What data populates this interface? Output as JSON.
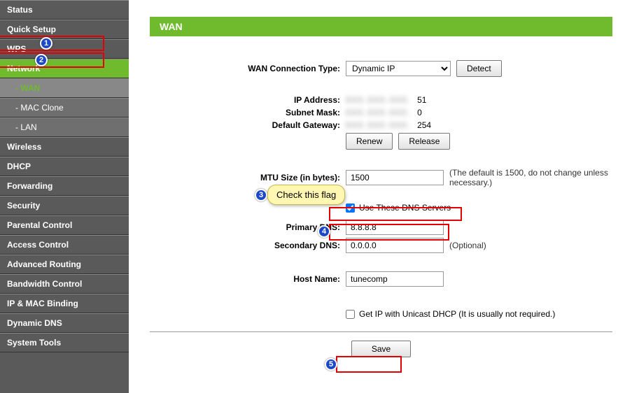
{
  "sidebar": {
    "items": [
      {
        "label": "Status"
      },
      {
        "label": "Quick Setup"
      },
      {
        "label": "WPS"
      },
      {
        "label": "Network"
      },
      {
        "label": "Wireless"
      },
      {
        "label": "DHCP"
      },
      {
        "label": "Forwarding"
      },
      {
        "label": "Security"
      },
      {
        "label": "Parental Control"
      },
      {
        "label": "Access Control"
      },
      {
        "label": "Advanced Routing"
      },
      {
        "label": "Bandwidth Control"
      },
      {
        "label": "IP & MAC Binding"
      },
      {
        "label": "Dynamic DNS"
      },
      {
        "label": "System Tools"
      }
    ],
    "network_subs": [
      {
        "label": "- WAN"
      },
      {
        "label": "- MAC Clone"
      },
      {
        "label": "- LAN"
      }
    ]
  },
  "page": {
    "title": "WAN"
  },
  "form": {
    "connection_type": {
      "label": "WAN Connection Type:",
      "value": "Dynamic IP"
    },
    "detect_button": "Detect",
    "ip_address": {
      "label": "IP Address:",
      "value_suffix": "51"
    },
    "subnet_mask": {
      "label": "Subnet Mask:",
      "value_suffix": "0"
    },
    "default_gateway": {
      "label": "Default Gateway:",
      "value_suffix": "254"
    },
    "renew_button": "Renew",
    "release_button": "Release",
    "mtu": {
      "label": "MTU Size (in bytes):",
      "value": "1500",
      "hint": "(The default is 1500, do not change unless necessary.)"
    },
    "use_dns": {
      "label": "Use These DNS Servers"
    },
    "primary_dns": {
      "label": "Primary DNS:",
      "value": "8.8.8.8"
    },
    "secondary_dns": {
      "label": "Secondary DNS:",
      "value": "0.0.0.0",
      "hint": "(Optional)"
    },
    "host_name": {
      "label": "Host Name:",
      "value": "tunecomp"
    },
    "unicast": {
      "label": "Get IP with Unicast DHCP (It is usually not required.)"
    },
    "save_button": "Save"
  },
  "annotations": {
    "callout": "Check this flag",
    "badges": [
      "1",
      "2",
      "3",
      "4",
      "5"
    ]
  }
}
